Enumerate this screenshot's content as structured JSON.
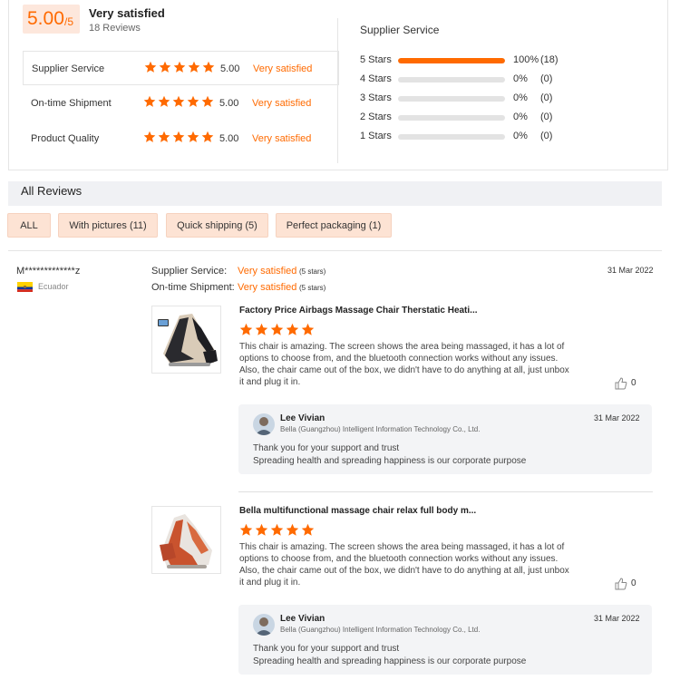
{
  "summary": {
    "score": "5.00",
    "score_suffix": "/5",
    "overall_label": "Very satisfied",
    "review_count": "18 Reviews",
    "accent_color": "#ff6a00",
    "metrics": [
      {
        "name": "Supplier Service",
        "rating": 5,
        "value": "5.00",
        "text": "Very satisfied"
      },
      {
        "name": "On-time Shipment",
        "rating": 5,
        "value": "5.00",
        "text": "Very satisfied"
      },
      {
        "name": "Product Quality",
        "rating": 5,
        "value": "5.00",
        "text": "Very satisfied"
      }
    ]
  },
  "distribution": {
    "title": "Supplier Service",
    "rows": [
      {
        "label": "5 Stars",
        "fraction": 1.0,
        "percent": "100%",
        "count": "(18)"
      },
      {
        "label": "4 Stars",
        "fraction": 0,
        "percent": "0%",
        "count": "(0)"
      },
      {
        "label": "3 Stars",
        "fraction": 0,
        "percent": "0%",
        "count": "(0)"
      },
      {
        "label": "2 Stars",
        "fraction": 0,
        "percent": "0%",
        "count": "(0)"
      },
      {
        "label": "1 Stars",
        "fraction": 0,
        "percent": "0%",
        "count": "(0)"
      }
    ]
  },
  "all_reviews": {
    "title": "All Reviews",
    "filters": [
      "ALL",
      "With pictures (11)",
      "Quick shipping (5)",
      "Perfect packaging (1)"
    ]
  },
  "review": {
    "reviewer": "M*************z",
    "country": "Ecuador",
    "date": "31 Mar 2022",
    "supplier_service_label": "Supplier Service:",
    "supplier_service_value": "Very satisfied",
    "supplier_service_note": "(5 stars)",
    "shipment_label": "On-time Shipment:",
    "shipment_value": "Very satisfied",
    "shipment_note": "(5 stars)",
    "items": [
      {
        "title": "Factory Price Airbags Massage Chair Therstatic Heati...",
        "rating": 5,
        "text_lines": [
          "This chair is amazing. The screen shows the area being massaged, it has a lot of",
          "options to choose from, and the bluetooth connection works without any issues.",
          "Also, the chair came out of the box, we didn't have to do anything at all, just unbox",
          "it and plug it in."
        ],
        "likes": "0",
        "thumb_icon": "black-massage-chair-image",
        "reply": {
          "name": "Lee Vivian",
          "company": "Bella (Guangzhou) Intelligent Information Technology Co., Ltd.",
          "date": "31 Mar 2022",
          "lines": [
            "Thank you for your support and trust",
            "Spreading health and spreading happiness is our corporate purpose"
          ]
        }
      },
      {
        "title": "Bella multifunctional massage chair relax full body m...",
        "rating": 5,
        "text_lines": [
          "This chair is amazing. The screen shows the area being massaged, it has a lot of",
          "options to choose from, and the bluetooth connection works without any issues.",
          "Also, the chair came out of the box, we didn't have to do anything at all, just unbox",
          "it and plug it in."
        ],
        "likes": "0",
        "thumb_icon": "orange-massage-chair-image",
        "reply": {
          "name": "Lee Vivian",
          "company": "Bella (Guangzhou) Intelligent Information Technology Co., Ltd.",
          "date": "31 Mar 2022",
          "lines": [
            "Thank you for your support and trust",
            "Spreading health and spreading happiness is our corporate purpose"
          ]
        }
      }
    ]
  }
}
